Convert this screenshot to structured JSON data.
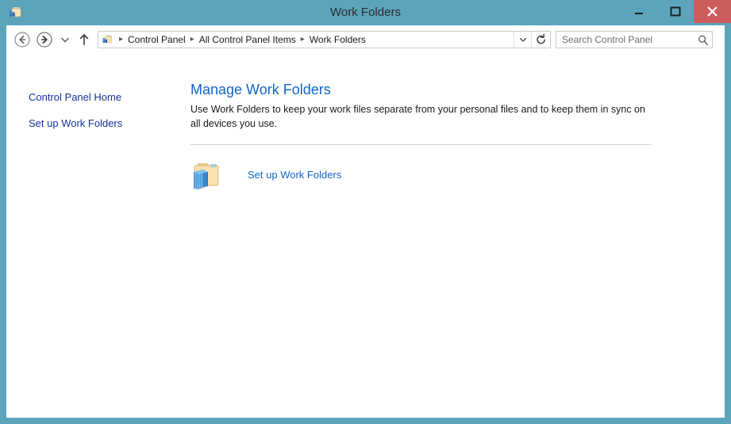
{
  "window": {
    "title": "Work Folders",
    "icon": "control-panel-folder-icon",
    "frame_color": "#5ba4bc",
    "controls": {
      "minimize_label": "Minimize",
      "maximize_label": "Maximize",
      "close_label": "Close",
      "close_color": "#cd5c5c"
    }
  },
  "navbar": {
    "back_label": "Back",
    "forward_label": "Forward",
    "recent_label": "Recent locations",
    "up_label": "Up one level",
    "address": {
      "icon": "control-panel-folder-icon",
      "breadcrumbs": [
        "Control Panel",
        "All Control Panel Items",
        "Work Folders"
      ],
      "separator": "▸",
      "dropdown_label": "Previous locations",
      "refresh_label": "Refresh"
    },
    "search": {
      "placeholder": "Search Control Panel",
      "value": "",
      "icon": "search-icon"
    }
  },
  "sidebar": {
    "items": [
      {
        "label": "Control Panel Home"
      },
      {
        "label": "Set up Work Folders"
      }
    ],
    "link_color": "#14309b"
  },
  "main": {
    "heading": "Manage Work Folders",
    "description": "Use Work Folders to keep your work files separate from your personal files and to keep them in sync on all devices you use.",
    "heading_color": "#1364c4",
    "action": {
      "icon": "work-folders-icon",
      "label": "Set up Work Folders",
      "link_color": "#1364c4"
    }
  }
}
